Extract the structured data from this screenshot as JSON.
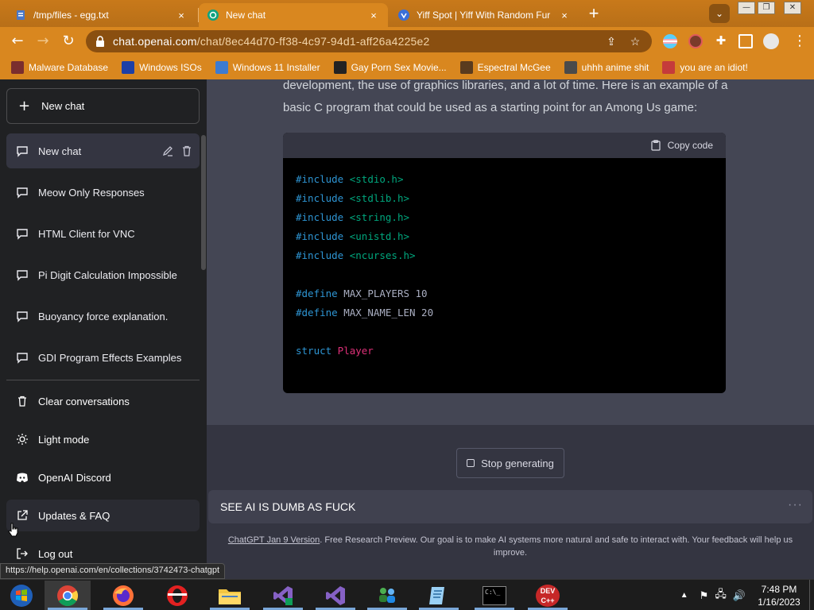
{
  "browser": {
    "tabs": [
      {
        "title": "/tmp/files - egg.txt",
        "close": "×",
        "active": false
      },
      {
        "title": "New chat",
        "close": "×",
        "active": true
      },
      {
        "title": "Yiff Spot | Yiff With Random Fur",
        "close": "×",
        "active": false
      }
    ],
    "new_tab": "+",
    "tab_search": "⌄",
    "window_controls": {
      "minimize": "—",
      "maximize": "❐",
      "close": "✕"
    },
    "url": {
      "host": "chat.openai.com",
      "path": "/chat/8ec44d70-ff38-4c97-94d1-aff26a4225e2"
    },
    "bookmarks": [
      {
        "label": "Malware Database",
        "color": "#7a2e2e"
      },
      {
        "label": "Windows ISOs",
        "color": "#1d3fa6"
      },
      {
        "label": "Windows 11 Installer",
        "color": "#3d7bd1"
      },
      {
        "label": "Gay Porn Sex Movie...",
        "color": "#222222"
      },
      {
        "label": "Espectral McGee",
        "color": "#5a3b1e"
      },
      {
        "label": "uhhh anime shit",
        "color": "#4a4a4a"
      },
      {
        "label": "you are an idiot!",
        "color": "#c53b3b"
      }
    ]
  },
  "sidebar": {
    "new_chat": "New chat",
    "conversations": [
      {
        "label": "New chat",
        "active": true
      },
      {
        "label": "Meow Only Responses"
      },
      {
        "label": "HTML Client for VNC"
      },
      {
        "label": "Pi Digit Calculation Impossible"
      },
      {
        "label": "Buoyancy force explanation."
      },
      {
        "label": "GDI Program Effects Examples"
      }
    ],
    "menu": [
      {
        "label": "Clear conversations",
        "icon": "trash-icon"
      },
      {
        "label": "Light mode",
        "icon": "sun-icon"
      },
      {
        "label": "OpenAI Discord",
        "icon": "discord-icon"
      },
      {
        "label": "Updates & FAQ",
        "icon": "external-link-icon"
      },
      {
        "label": "Log out",
        "icon": "logout-icon"
      }
    ]
  },
  "chat": {
    "reply_line1": "development, the use of graphics libraries, and a lot of time. Here is an example of a",
    "reply_line2": "basic C program that could be used as a starting point for an Among Us game:",
    "copy_code": "Copy code",
    "code_lines": [
      [
        {
          "t": "#include",
          "c": "kw"
        },
        {
          "t": " <stdio.h>",
          "c": "str"
        }
      ],
      [
        {
          "t": "#include",
          "c": "kw"
        },
        {
          "t": " <stdlib.h>",
          "c": "str"
        }
      ],
      [
        {
          "t": "#include",
          "c": "kw"
        },
        {
          "t": " <string.h>",
          "c": "str"
        }
      ],
      [
        {
          "t": "#include",
          "c": "kw"
        },
        {
          "t": " <unistd.h>",
          "c": "str"
        }
      ],
      [
        {
          "t": "#include",
          "c": "kw"
        },
        {
          "t": " <ncurses.h>",
          "c": "str"
        }
      ],
      [],
      [
        {
          "t": "#define",
          "c": "kw"
        },
        {
          "t": " MAX_PLAYERS 10",
          "c": "pp"
        }
      ],
      [
        {
          "t": "#define",
          "c": "kw"
        },
        {
          "t": " MAX_NAME_LEN 20",
          "c": "pp"
        }
      ],
      [],
      [
        {
          "t": "struct",
          "c": "kw"
        },
        {
          "t": " Player",
          "c": "typ"
        }
      ]
    ],
    "stop_generating": "Stop generating",
    "prompt_text": "SEE AI IS DUMB AS FUCK",
    "prompt_more": "···",
    "footer_link": "ChatGPT Jan 9 Version",
    "footer_text": ". Free Research Preview. Our goal is to make AI systems more natural and safe to interact with. Your feedback will help us improve."
  },
  "status_url": "https://help.openai.com/en/collections/3742473-chatgpt",
  "taskbar": {
    "apps": [
      "start-button",
      "chrome-app",
      "firefox-app",
      "opera-app",
      "file-explorer-app",
      "visual-studio-preview-app",
      "visual-studio-app",
      "network-app",
      "notepad-app",
      "terminal-app",
      "devcpp-app"
    ],
    "time": "7:48 PM",
    "date": "1/16/2023",
    "devcpp_label": "DEV\nC++",
    "terminal_label": "C:\\_"
  }
}
